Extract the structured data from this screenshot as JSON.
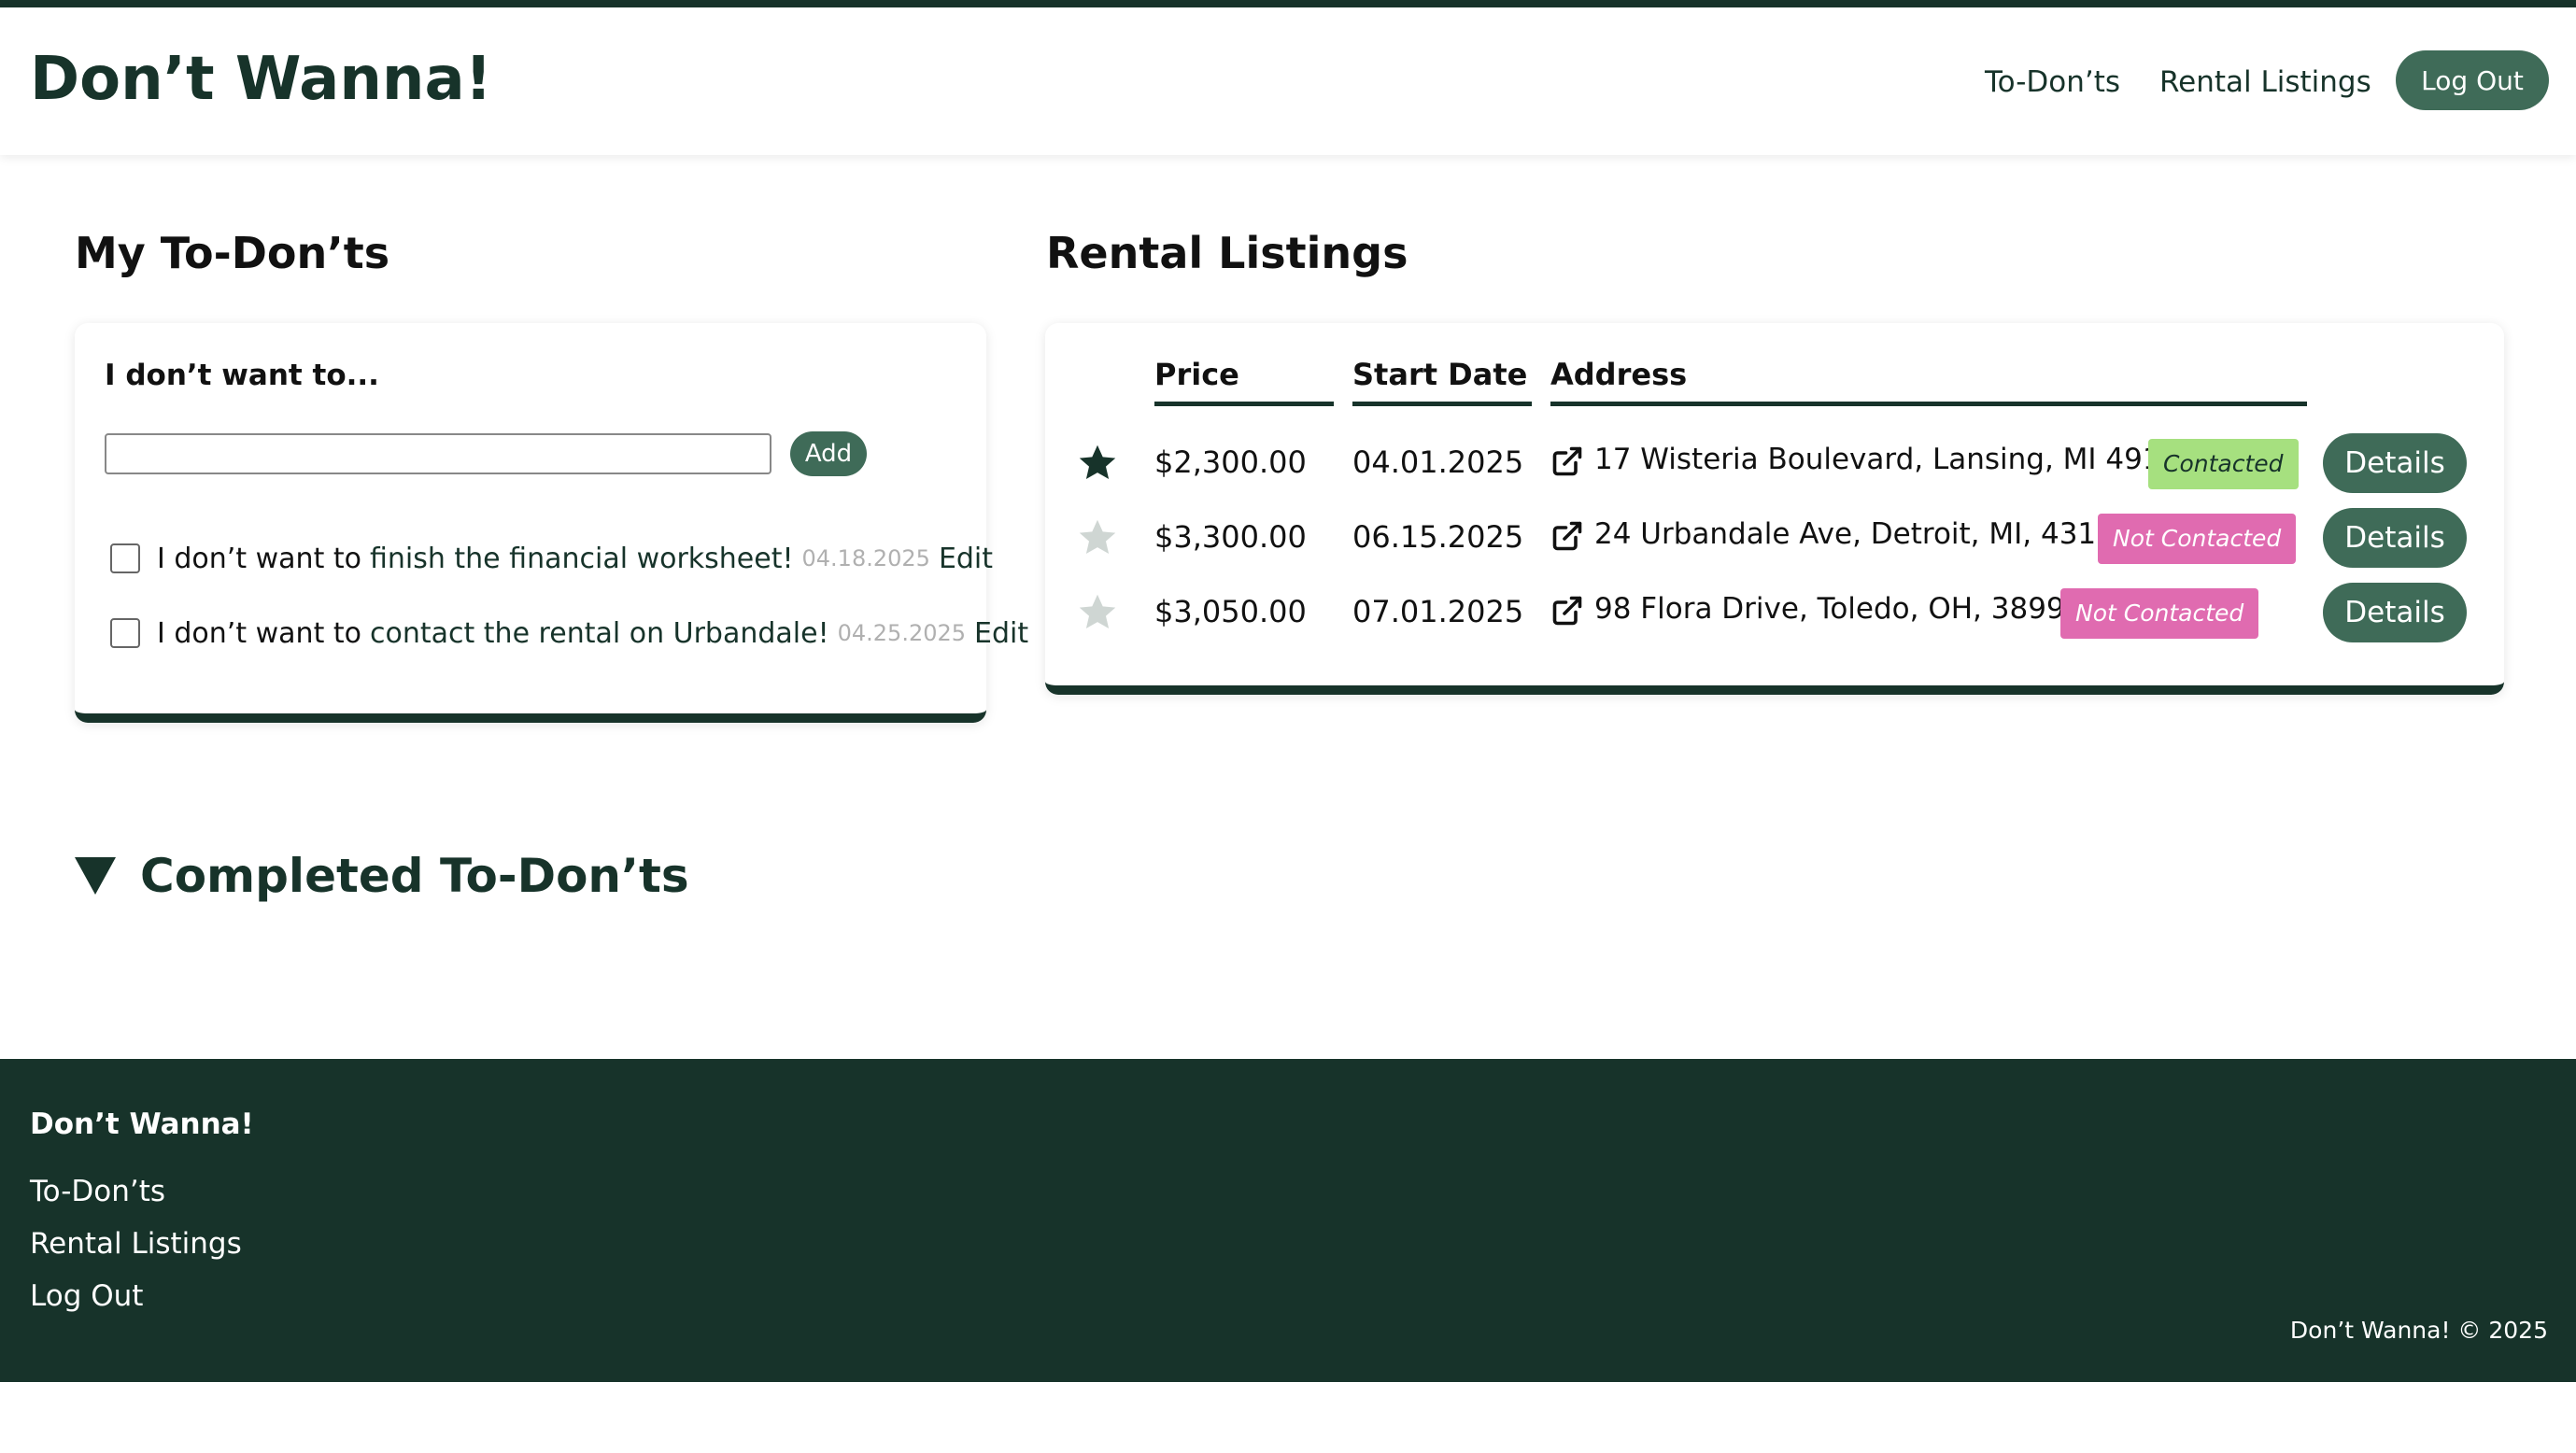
{
  "header": {
    "brand": "Don’t Wanna!",
    "nav": [
      "To-Don’ts",
      "Rental Listings"
    ],
    "logout_label": "Log Out"
  },
  "todonts": {
    "title": "My To-Don’ts",
    "card_heading": "I don’t want to...",
    "input_value": "",
    "add_label": "Add",
    "items": [
      {
        "prefix": "I don’t want to",
        "text": "finish the financial worksheet!",
        "date": "04.18.2025",
        "edit": "Edit",
        "checked": false
      },
      {
        "prefix": "I don’t want to",
        "text": "contact the rental on Urbandale!",
        "date": "04.25.2025",
        "edit": "Edit",
        "checked": false
      }
    ]
  },
  "rentals": {
    "title": "Rental Listings",
    "columns": [
      "Price",
      "Start Date",
      "Address"
    ],
    "rows": [
      {
        "starred": true,
        "price": "$2,300.00",
        "start_date": "04.01.2025",
        "address": "17 Wisteria Boulevard, Lansing, MI 49101",
        "status": "Contacted",
        "details": "Details"
      },
      {
        "starred": false,
        "price": "$3,300.00",
        "start_date": "06.15.2025",
        "address": "24 Urbandale Ave, Detroit, MI, 43109",
        "status": "Not Contacted",
        "details": "Details"
      },
      {
        "starred": false,
        "price": "$3,050.00",
        "start_date": "07.01.2025",
        "address": "98 Flora Drive, Toledo, OH, 38991",
        "status": "Not Contacted",
        "details": "Details"
      }
    ]
  },
  "completed": {
    "title": "Completed To-Don’ts"
  },
  "footer": {
    "brand": "Don’t Wanna!",
    "links": [
      "To-Don’ts",
      "Rental Listings",
      "Log Out"
    ],
    "copyright": "Don’t Wanna! © 2025"
  },
  "colors": {
    "primary_dark": "#17332a",
    "button": "#3f6b58",
    "contacted": "#a6e07f",
    "not_contacted": "#e06bb0",
    "star_active": "#17332a",
    "star_inactive": "#cfd6d3"
  },
  "icons": {
    "star": "star-icon",
    "external_link": "external-link-icon",
    "collapse_triangle": "triangle-down-icon"
  }
}
